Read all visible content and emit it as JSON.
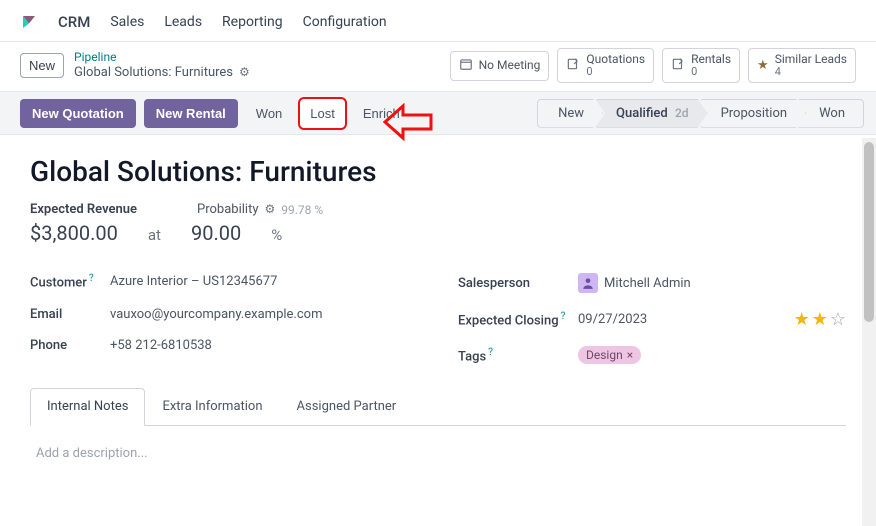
{
  "nav": {
    "app": "CRM",
    "links": [
      "Sales",
      "Leads",
      "Reporting",
      "Configuration"
    ]
  },
  "breadcrumb": {
    "new_label": "New",
    "parent": "Pipeline",
    "record": "Global Solutions: Furnitures"
  },
  "header_stats": {
    "no_meeting": "No Meeting",
    "quotations_label": "Quotations",
    "quotations_count": "0",
    "rentals_label": "Rentals",
    "rentals_count": "0",
    "similar_label": "Similar Leads",
    "similar_count": "4"
  },
  "actions": {
    "new_quotation": "New Quotation",
    "new_rental": "New Rental",
    "won": "Won",
    "lost": "Lost",
    "enrich": "Enrich"
  },
  "stages": {
    "s1": "New",
    "s2": "Qualified",
    "s2_days": "2d",
    "s3": "Proposition",
    "s4": "Won"
  },
  "form": {
    "title": "Global Solutions: Furnitures",
    "expected_revenue_label": "Expected Revenue",
    "expected_revenue_value": "$3,800.00",
    "at": "at",
    "prob_label": "Probability",
    "prob_hint": "99.78 %",
    "prob_value": "90.00",
    "pct": "%",
    "customer_label": "Customer",
    "customer_value": "Azure Interior – US12345677",
    "email_label": "Email",
    "email_value": "vauxoo@yourcompany.example.com",
    "phone_label": "Phone",
    "phone_value": "+58 212-6810538",
    "salesperson_label": "Salesperson",
    "salesperson_value": "Mitchell Admin",
    "closing_label": "Expected Closing",
    "closing_value": "09/27/2023",
    "tags_label": "Tags",
    "tag_value": "Design"
  },
  "tabs": {
    "t1": "Internal Notes",
    "t2": "Extra Information",
    "t3": "Assigned Partner"
  },
  "description_placeholder": "Add a description...",
  "help_mark": "?"
}
